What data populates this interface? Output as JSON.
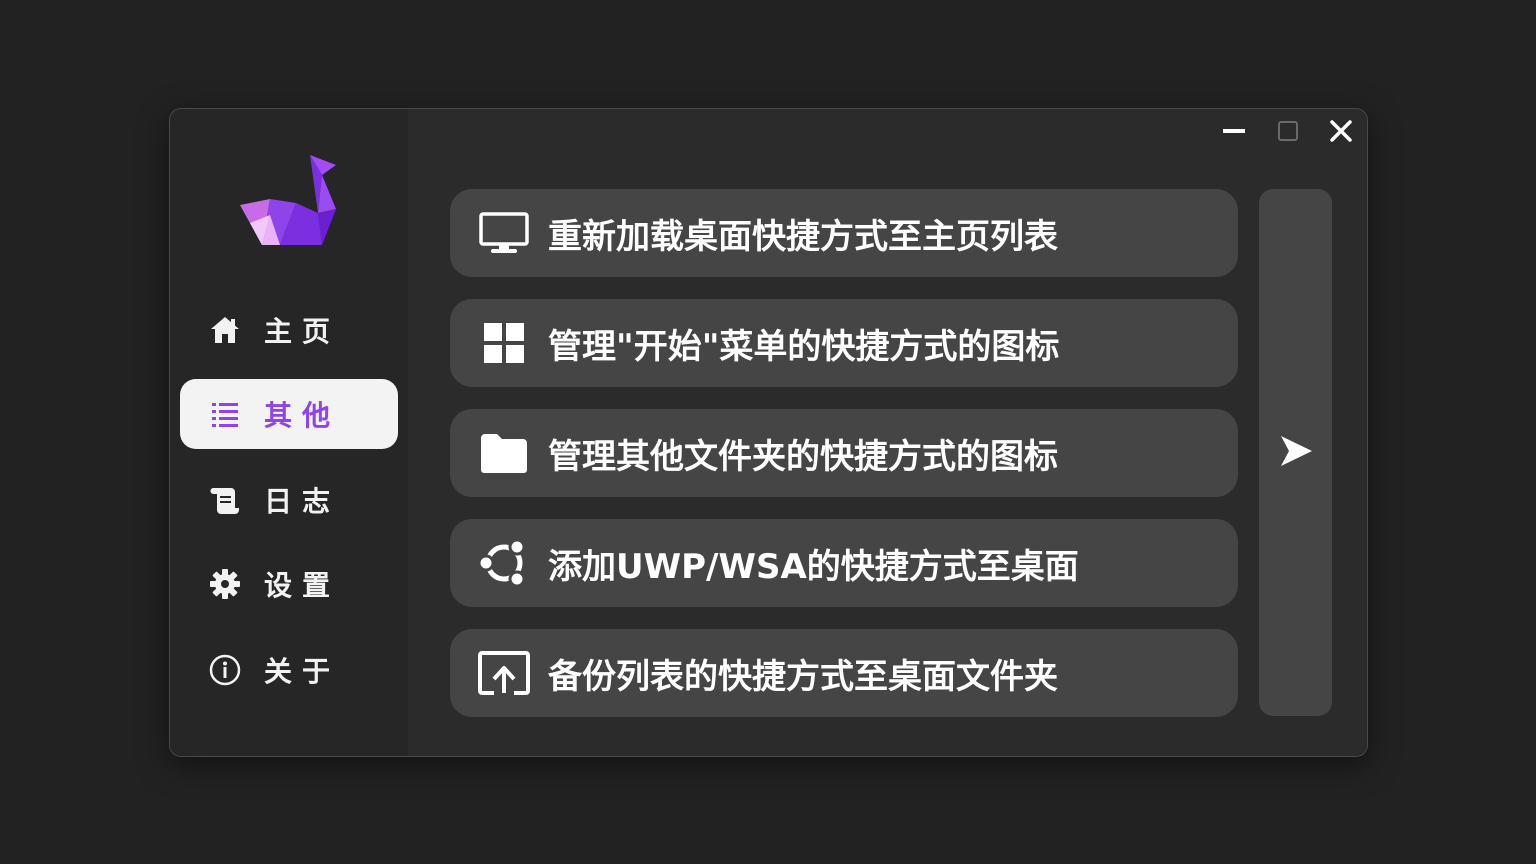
{
  "window": {
    "controls": {
      "minimize_icon": "minimize-icon",
      "maximize_icon": "maximize-icon",
      "close_icon": "close-icon"
    }
  },
  "colors": {
    "accent": "#8e44e8",
    "background": "#222222",
    "window": "#2b2b2b",
    "sidebar": "#262626",
    "card": "#454545",
    "active_nav_bg": "#f3f3f3"
  },
  "sidebar": {
    "logo_icon": "origami-swan-logo",
    "items": [
      {
        "label": "主页",
        "icon": "home-icon",
        "active": false
      },
      {
        "label": "其他",
        "icon": "list-icon",
        "active": true
      },
      {
        "label": "日志",
        "icon": "scroll-icon",
        "active": false
      },
      {
        "label": "设置",
        "icon": "gear-icon",
        "active": false
      },
      {
        "label": "关于",
        "icon": "info-icon",
        "active": false
      }
    ]
  },
  "actions": [
    {
      "label": "重新加载桌面快捷方式至主页列表",
      "icon": "monitor-icon"
    },
    {
      "label": "管理\"开始\"菜单的快捷方式的图标",
      "icon": "windows-start-icon"
    },
    {
      "label": "管理其他文件夹的快捷方式的图标",
      "icon": "folder-icon"
    },
    {
      "label": "添加UWP/WSA的快捷方式至桌面",
      "icon": "ubuntu-icon"
    },
    {
      "label": "备份列表的快捷方式至桌面文件夹",
      "icon": "upload-screen-icon"
    }
  ],
  "go_button": {
    "icon": "send-arrow-icon"
  }
}
